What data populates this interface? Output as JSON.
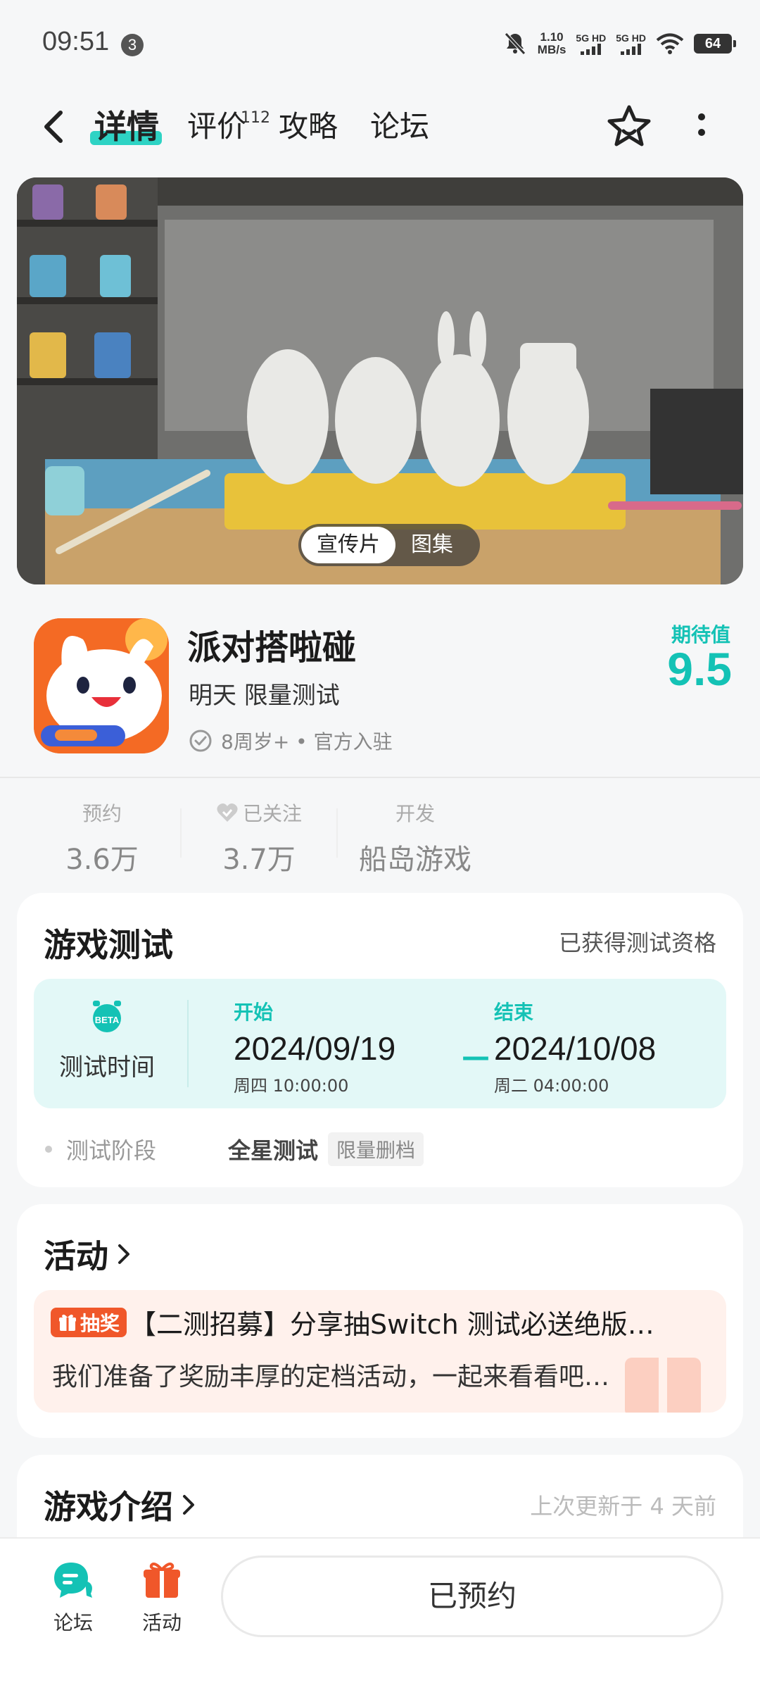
{
  "status_bar": {
    "time": "09:51",
    "notif_count": "3",
    "net_speed_value": "1.10",
    "net_speed_unit": "MB/s",
    "sim1": "5G HD",
    "sim2": "5G HD",
    "battery": "64"
  },
  "nav": {
    "tabs": [
      {
        "label": "详情",
        "active": true
      },
      {
        "label": "评价",
        "badge": "112"
      },
      {
        "label": "攻略"
      },
      {
        "label": "论坛"
      }
    ]
  },
  "hero": {
    "switch": [
      "宣传片",
      "图集"
    ]
  },
  "game": {
    "name": "派对搭啦碰",
    "subtitle": "明天 限量测试",
    "tags": "8周岁+ • 官方入驻",
    "expect_label": "期待值",
    "expect_score": "9.5"
  },
  "stats": [
    {
      "label": "预约",
      "value": "3.6万"
    },
    {
      "label": "已关注",
      "value": "3.7万"
    },
    {
      "label": "开发",
      "value": "船岛游戏"
    }
  ],
  "test": {
    "title": "游戏测试",
    "qualification": "已获得测试资格",
    "beta_tag": "BETA",
    "time_label": "测试时间",
    "start_label": "开始",
    "start_date": "2024/09/19",
    "start_time": "周四  10:00:00",
    "dash": "—",
    "end_label": "结束",
    "end_date": "2024/10/08",
    "end_time": "周二  04:00:00",
    "phase_label": "测试阶段",
    "phase_value": "全星测试",
    "phase_chip": "限量删档"
  },
  "activity": {
    "title": "活动",
    "tag": "抽奖",
    "headline": "【二测招募】分享抽Switch 测试必送绝版…",
    "desc": "我们准备了奖励丰厚的定档活动，一起来看看吧…"
  },
  "intro": {
    "title": "游戏介绍",
    "updated": "上次更新于 4 天前"
  },
  "bottom": {
    "forum": "论坛",
    "activity": "活动",
    "reserve_btn": "已预约"
  },
  "colors": {
    "accent": "#14c2b5",
    "highlight": "#2ed3c4",
    "activity_tag": "#f0572a",
    "test_box_bg": "#e3f8f7",
    "activity_box_bg": "#fff1ec"
  }
}
